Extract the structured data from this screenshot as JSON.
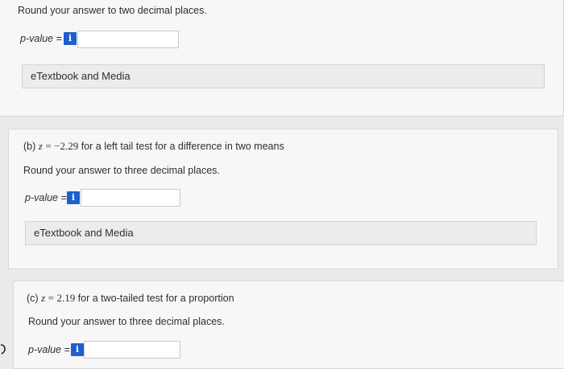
{
  "part_a": {
    "instruction": "Round your answer to two decimal places.",
    "pvalue_label": "p-value =",
    "info_glyph": "i",
    "answer_value": "",
    "etextbook_label": "eTextbook and Media"
  },
  "part_b": {
    "prefix": "(b)",
    "z_var": "z",
    "equals": "=",
    "z_value": "−2.29",
    "description": "for a left tail test for a difference in two means",
    "instruction": "Round your answer to three decimal places.",
    "pvalue_label": "p-value =",
    "info_glyph": "i",
    "answer_value": "",
    "etextbook_label": "eTextbook and Media"
  },
  "part_c": {
    "prefix": "(c)",
    "z_var": "z",
    "equals": "=",
    "z_value": "2.19",
    "description": "for a two-tailed test for a proportion",
    "instruction": "Round your answer to three decimal places.",
    "pvalue_label": "p-value =",
    "info_glyph": "i",
    "answer_value": ""
  },
  "icons": {
    "info": "info-icon",
    "edge": "curved-arrow-icon"
  },
  "colors": {
    "info_button": "#1e5fd0",
    "panel_bg": "#f7f7f7",
    "page_bg": "#e9eaeb"
  }
}
